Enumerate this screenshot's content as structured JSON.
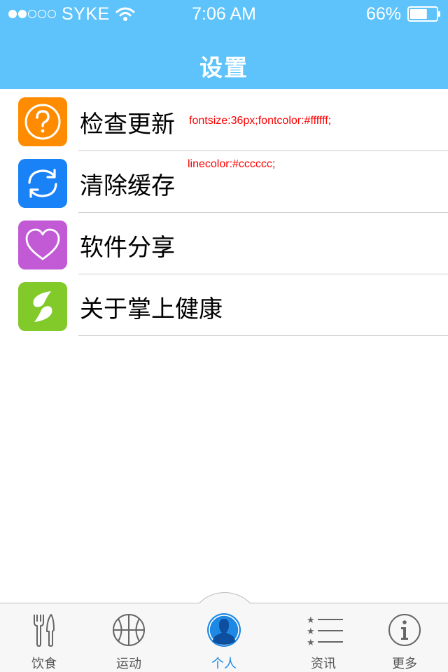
{
  "status_bar": {
    "carrier": "SYKE",
    "time": "7:06 AM",
    "battery": "66%",
    "battery_fraction": 0.66,
    "signal_filled": 2,
    "signal_total": 5
  },
  "nav": {
    "title": "设置"
  },
  "settings": {
    "items": [
      {
        "label": "检查更新",
        "icon": "question-icon",
        "color": "#ff8c00"
      },
      {
        "label": "清除缓存",
        "icon": "refresh-icon",
        "color": "#1a82f7"
      },
      {
        "label": "软件分享",
        "icon": "heart-icon",
        "color": "#c25ad6"
      },
      {
        "label": "关于掌上健康",
        "icon": "leaf-logo-icon",
        "color": "#82c92a"
      }
    ]
  },
  "annotations": {
    "font_note": "fontsize:36px;fontcolor:#ffffff;",
    "line_note": "linecolor:#cccccc;"
  },
  "tabs": [
    {
      "label": "饮食",
      "icon": "fork-knife-icon",
      "active": false
    },
    {
      "label": "运动",
      "icon": "basketball-icon",
      "active": false
    },
    {
      "label": "个人",
      "icon": "person-icon",
      "active": true
    },
    {
      "label": "资讯",
      "icon": "news-list-icon",
      "active": false
    },
    {
      "label": "更多",
      "icon": "info-icon",
      "active": false
    }
  ],
  "colors": {
    "header": "#5ec3fb",
    "divider": "#cccccc",
    "active_tab": "#1e88e5",
    "annotation": "#ff0000"
  }
}
